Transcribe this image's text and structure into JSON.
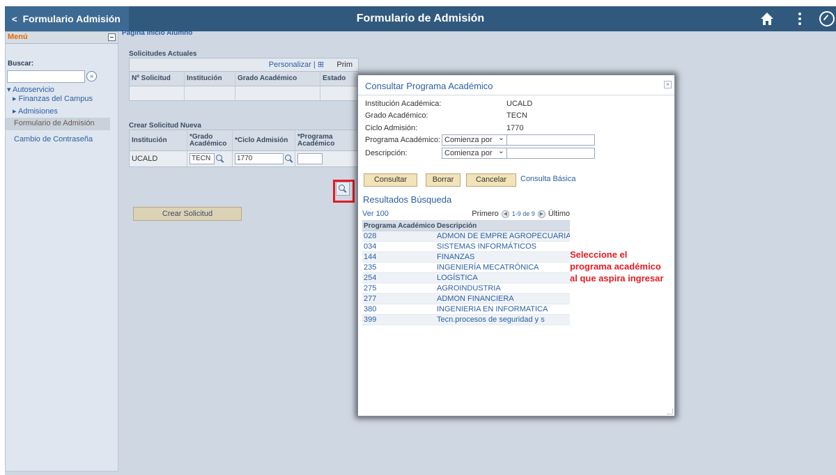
{
  "header": {
    "back_label": "Formulario Admisión",
    "title": "Formulario de Admisión"
  },
  "sidebar": {
    "title": "Menú",
    "search_label": "Buscar:",
    "items": [
      {
        "label": "Autoservicio"
      },
      {
        "label": "Finanzas del Campus"
      },
      {
        "label": "Admisiones"
      },
      {
        "label": "Formulario de Admisión"
      },
      {
        "label": "Cambio de Contraseña"
      }
    ]
  },
  "main": {
    "page_label": "Página Inicio Alumno",
    "solicitudes_actuales": {
      "title": "Solicitudes Actuales",
      "personalize": "Personalizar |",
      "first": "Prim",
      "columns": [
        "Nº Solicitud",
        "Institución",
        "Grado Académico",
        "Estado"
      ]
    },
    "crear_nueva": {
      "title": "Crear Solicitud Nueva",
      "columns": [
        "Institución",
        "*Grado Académico",
        "*Ciclo Admisión",
        "*Programa Académico"
      ],
      "row": {
        "institucion": "UCALD",
        "grado": "TECN",
        "ciclo": "1770",
        "programa": ""
      },
      "button": "Crear Solicitud"
    }
  },
  "modal": {
    "title": "Consultar Programa Académico",
    "fields": [
      {
        "label": "Institución Académica:",
        "value": "UCALD"
      },
      {
        "label": "Grado Académico:",
        "value": "TECN"
      },
      {
        "label": "Ciclo Admisión:",
        "value": "1770"
      }
    ],
    "programa_label": "Programa Académico:",
    "descripcion_label": "Descripción:",
    "operator": "Comienza por",
    "buttons": {
      "consultar": "Consultar",
      "borrar": "Borrar",
      "cancelar": "Cancelar"
    },
    "basic_link": "Consulta Básica",
    "results_title": "Resultados Búsqueda",
    "nav": {
      "view": "Ver 100",
      "first": "Primero",
      "range": "1-9 de 9",
      "last": "Último"
    },
    "columns": [
      "Programa Académico",
      "Descripción"
    ],
    "rows": [
      {
        "code": "028",
        "desc": "ADMON DE EMPRE AGROPECUARIAS"
      },
      {
        "code": "034",
        "desc": "SISTEMAS INFORMÁTICOS"
      },
      {
        "code": "144",
        "desc": "FINANZAS"
      },
      {
        "code": "235",
        "desc": "INGENIERÍA MECATRÓNICA"
      },
      {
        "code": "254",
        "desc": "LOGÍSTICA"
      },
      {
        "code": "275",
        "desc": "AGROINDUSTRIA"
      },
      {
        "code": "277",
        "desc": "ADMON FINANCIERA"
      },
      {
        "code": "380",
        "desc": "INGENIERIA EN INFORMATICA"
      },
      {
        "code": "399",
        "desc": "Tecn.procesos de seguridad y s"
      }
    ],
    "annotation": "Seleccione el programa académico al que aspira ingresar"
  },
  "colors": {
    "header": "#31597d",
    "accent": "#e31b23",
    "link": "#2b5fa5"
  }
}
